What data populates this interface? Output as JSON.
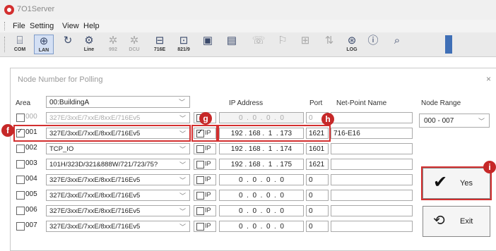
{
  "app": {
    "title": "7O1Server"
  },
  "menu": [
    "File",
    "Setting",
    "View",
    "Help"
  ],
  "toolbar": [
    {
      "icon": "com-port-icon",
      "glyph": "⌸",
      "label": "COM",
      "state": "normal"
    },
    {
      "icon": "lan-icon",
      "glyph": "⊕",
      "label": "LAN",
      "state": "active"
    },
    {
      "icon": "refresh-icon",
      "glyph": "↻",
      "label": "",
      "state": "normal"
    },
    {
      "icon": "line-icon",
      "glyph": "⚙",
      "label": "Line",
      "state": "normal"
    },
    {
      "icon": "module-992-icon",
      "glyph": "✲",
      "label": "992",
      "state": "disabled"
    },
    {
      "icon": "module-dcu-icon",
      "glyph": "✲",
      "label": "DCU",
      "state": "disabled"
    },
    {
      "icon": "module-716e-icon",
      "glyph": "⊟",
      "label": "716E",
      "state": "normal"
    },
    {
      "icon": "module-821-icon",
      "glyph": "⊡",
      "label": "821/9",
      "state": "normal"
    },
    {
      "icon": "device-h-icon",
      "glyph": "▣",
      "label": "",
      "state": "normal"
    },
    {
      "icon": "device-e-icon",
      "glyph": "▤",
      "label": "",
      "state": "normal"
    },
    {
      "icon": "phone-icon",
      "glyph": "☏",
      "label": "",
      "state": "disabled"
    },
    {
      "icon": "antenna-icon",
      "glyph": "⚐",
      "label": "",
      "state": "disabled"
    },
    {
      "icon": "network-icon",
      "glyph": "⊞",
      "label": "",
      "state": "disabled"
    },
    {
      "icon": "pin-icon",
      "glyph": "⇅",
      "label": "",
      "state": "disabled"
    },
    {
      "icon": "log-icon",
      "glyph": "⊛",
      "label": "LOG",
      "state": "normal"
    },
    {
      "icon": "info-icon",
      "glyph": "ⓘ",
      "label": "",
      "state": "normal"
    },
    {
      "icon": "search-icon",
      "glyph": "⌕",
      "label": "",
      "state": "normal"
    }
  ],
  "dialog": {
    "title": "Node Number for Polling",
    "area_label": "Area",
    "area_value": "00:BuildingA",
    "headers": {
      "ip": "IP Address",
      "port": "Port",
      "net_point": "Net-Point Name",
      "node_range": "Node Range"
    },
    "node_range": "000 - 007",
    "ip_check_label": "IP",
    "rows": [
      {
        "checked": false,
        "num": "000",
        "type": "327E/3xxE/7xxE/8xxE/716Ev5",
        "ip_checked": false,
        "ip": "0  .  0  .  0  .  0",
        "port": "0",
        "net": "",
        "dim": true
      },
      {
        "checked": true,
        "num": "001",
        "type": "327E/3xxE/7xxE/8xxE/716Ev5",
        "ip_checked": true,
        "ip": "192 . 168 .  1  . 173",
        "port": "1621",
        "net": "716-E16",
        "dim": false
      },
      {
        "checked": false,
        "num": "002",
        "type": "TCP_IO",
        "ip_checked": false,
        "ip": "192 . 168 .  1  . 174",
        "port": "1601",
        "net": "",
        "dim": false
      },
      {
        "checked": false,
        "num": "003",
        "type": "101H/323D/321&888W/721/723/75?",
        "ip_checked": false,
        "ip": "192 . 168 .  1  . 175",
        "port": "1621",
        "net": "",
        "dim": false
      },
      {
        "checked": false,
        "num": "004",
        "type": "327E/3xxE/7xxE/8xxE/716Ev5",
        "ip_checked": false,
        "ip": "0  .  0  .  0  .  0",
        "port": "0",
        "net": "",
        "dim": false
      },
      {
        "checked": false,
        "num": "005",
        "type": "327E/3xxE/7xxE/8xxE/716Ev5",
        "ip_checked": false,
        "ip": "0  .  0  .  0  .  0",
        "port": "0",
        "net": "",
        "dim": false
      },
      {
        "checked": false,
        "num": "006",
        "type": "327E/3xxE/7xxE/8xxE/716Ev5",
        "ip_checked": false,
        "ip": "0  .  0  .  0  .  0",
        "port": "0",
        "net": "",
        "dim": false
      },
      {
        "checked": false,
        "num": "007",
        "type": "327E/3xxE/7xxE/8xxE/716Ev5",
        "ip_checked": false,
        "ip": "0  .  0  .  0  .  0",
        "port": "0",
        "net": "",
        "dim": false
      }
    ],
    "buttons": {
      "yes": "Yes",
      "exit": "Exit"
    }
  },
  "markers": {
    "f": "f",
    "g": "g",
    "h": "h",
    "i": "i"
  },
  "colors": {
    "highlight": "#d32f2f",
    "marker": "#c62828",
    "lan_active": "#d4e0f4"
  }
}
